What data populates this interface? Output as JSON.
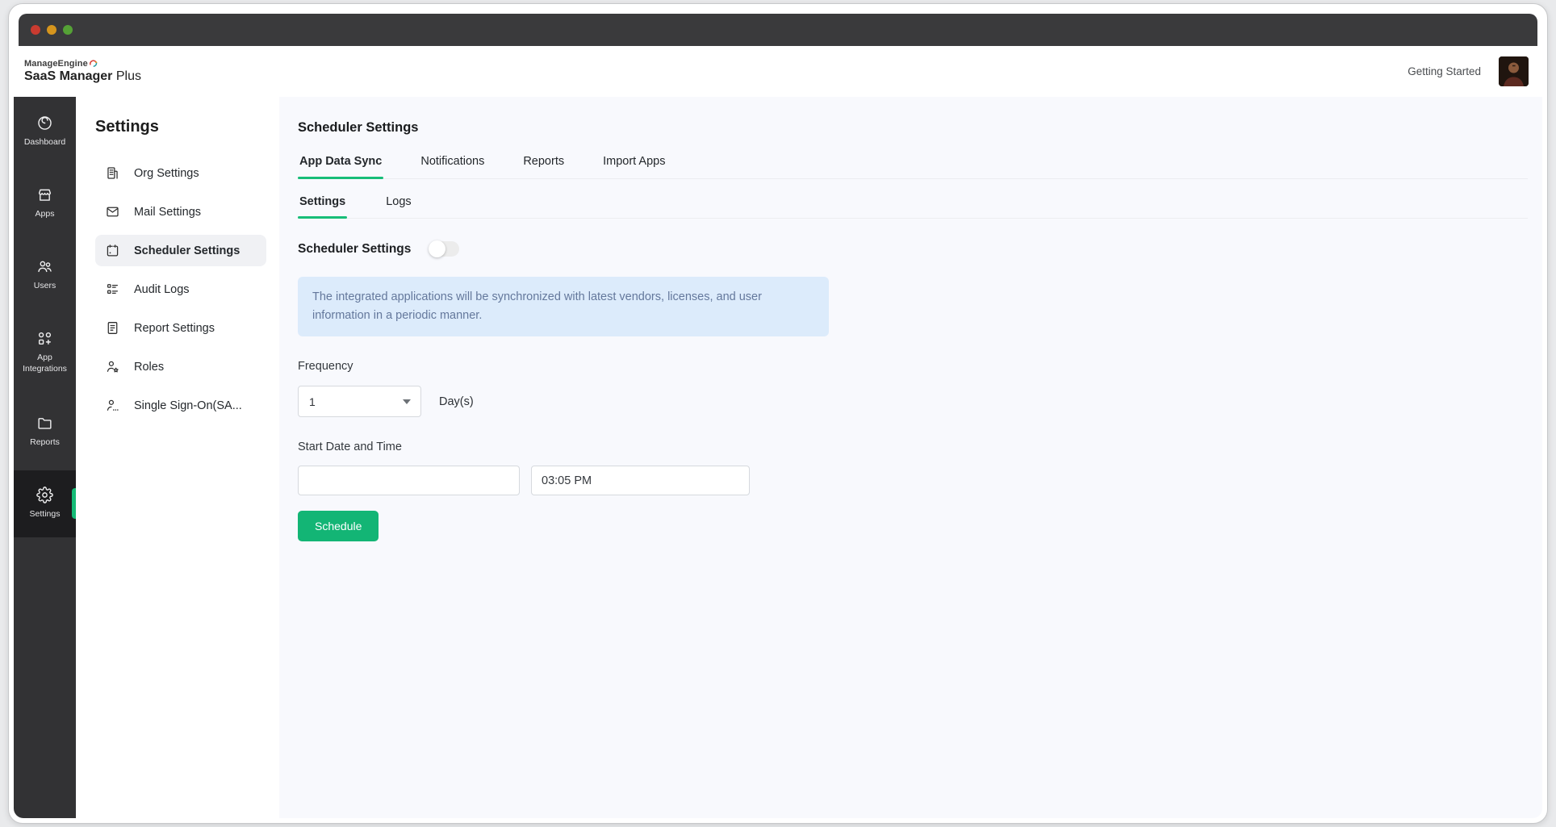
{
  "window": {
    "traffic_lights": [
      "close",
      "minimize",
      "zoom"
    ]
  },
  "header": {
    "brand_top": "ManageEngine",
    "brand_bold": "SaaS Manager",
    "brand_suffix": " Plus",
    "getting_started": "Getting Started",
    "avatar": "user-profile-photo"
  },
  "nav": {
    "items": [
      {
        "label": "Dashboard",
        "icon": "dashboard-icon",
        "active": false
      },
      {
        "label": "Apps",
        "icon": "apps-icon",
        "active": false
      },
      {
        "label": "Users",
        "icon": "users-icon",
        "active": false
      },
      {
        "label": "App Integrations",
        "icon": "app-integrations-icon",
        "active": false
      },
      {
        "label": "Reports",
        "icon": "reports-icon",
        "active": false
      },
      {
        "label": "Settings",
        "icon": "settings-gear-icon",
        "active": true
      }
    ]
  },
  "sidebar": {
    "title": "Settings",
    "items": [
      {
        "label": "Org Settings",
        "icon": "org-building-icon",
        "selected": false
      },
      {
        "label": "Mail Settings",
        "icon": "mail-envelope-icon",
        "selected": false
      },
      {
        "label": "Scheduler Settings",
        "icon": "scheduler-calendar-icon",
        "selected": true
      },
      {
        "label": "Audit Logs",
        "icon": "audit-logs-icon",
        "selected": false
      },
      {
        "label": "Report Settings",
        "icon": "report-document-icon",
        "selected": false
      },
      {
        "label": "Roles",
        "icon": "roles-person-star-icon",
        "selected": false
      },
      {
        "label": "Single Sign-On(SA...",
        "icon": "sso-person-dots-icon",
        "selected": false
      }
    ]
  },
  "main": {
    "page_title": "Scheduler Settings",
    "tabs": [
      {
        "label": "App Data Sync",
        "active": true
      },
      {
        "label": "Notifications",
        "active": false
      },
      {
        "label": "Reports",
        "active": false
      },
      {
        "label": "Import Apps",
        "active": false
      }
    ],
    "subtabs": [
      {
        "label": "Settings",
        "active": true
      },
      {
        "label": "Logs",
        "active": false
      }
    ],
    "scheduler_toggle": {
      "label": "Scheduler Settings",
      "state": "off"
    },
    "info_text": "The integrated applications will be synchronized with latest vendors, licenses, and user information in a periodic manner.",
    "frequency": {
      "label": "Frequency",
      "value": "1",
      "unit": "Day(s)"
    },
    "start": {
      "label": "Start Date and Time",
      "date_value": "",
      "time_value": "03:05 PM"
    },
    "schedule_button": "Schedule"
  },
  "colors": {
    "accent_green": "#15bb76",
    "button_green": "#13b575",
    "titlebar": "#3a3a3c",
    "nav_bg": "#323234",
    "nav_active_bg": "#1d1d1f",
    "main_bg": "#f8f9fd",
    "sidebar_selected_bg": "#f0f1f4",
    "info_bg": "#dcebfb",
    "info_text": "#64789c",
    "traffic_red": "#c93b30",
    "traffic_yellow": "#d6951d",
    "traffic_green": "#55a136"
  }
}
